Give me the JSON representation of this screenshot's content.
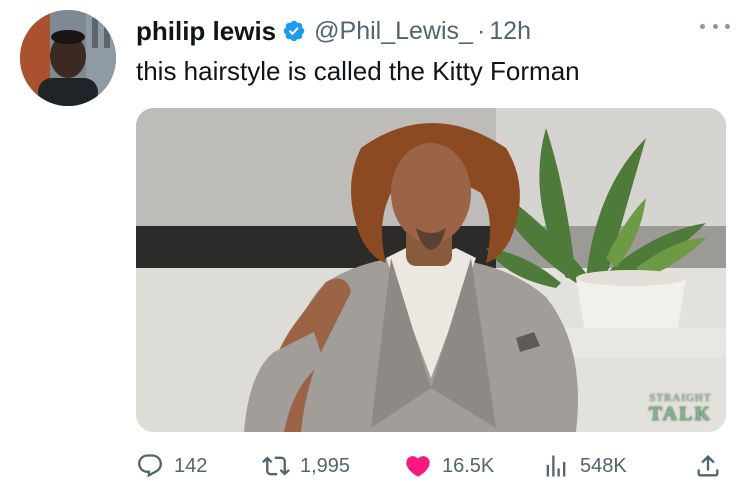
{
  "tweet": {
    "author_name": "philip lewis",
    "handle": "@Phil_Lewis_",
    "separator": "·",
    "time": "12h",
    "text": "this hairstyle is called the Kitty Forman"
  },
  "media": {
    "watermark_top": "STRAIGHT",
    "watermark_bottom": "TALK"
  },
  "actions": {
    "replies": "142",
    "retweets": "1,995",
    "likes": "16.5K",
    "views": "548K"
  },
  "colors": {
    "verified": "#1d9bf0",
    "like": "#f91880",
    "secondary_text": "#536471"
  },
  "icons": [
    "verified-badge-icon",
    "more-icon",
    "reply-icon",
    "retweet-icon",
    "like-icon",
    "views-icon",
    "share-icon"
  ]
}
